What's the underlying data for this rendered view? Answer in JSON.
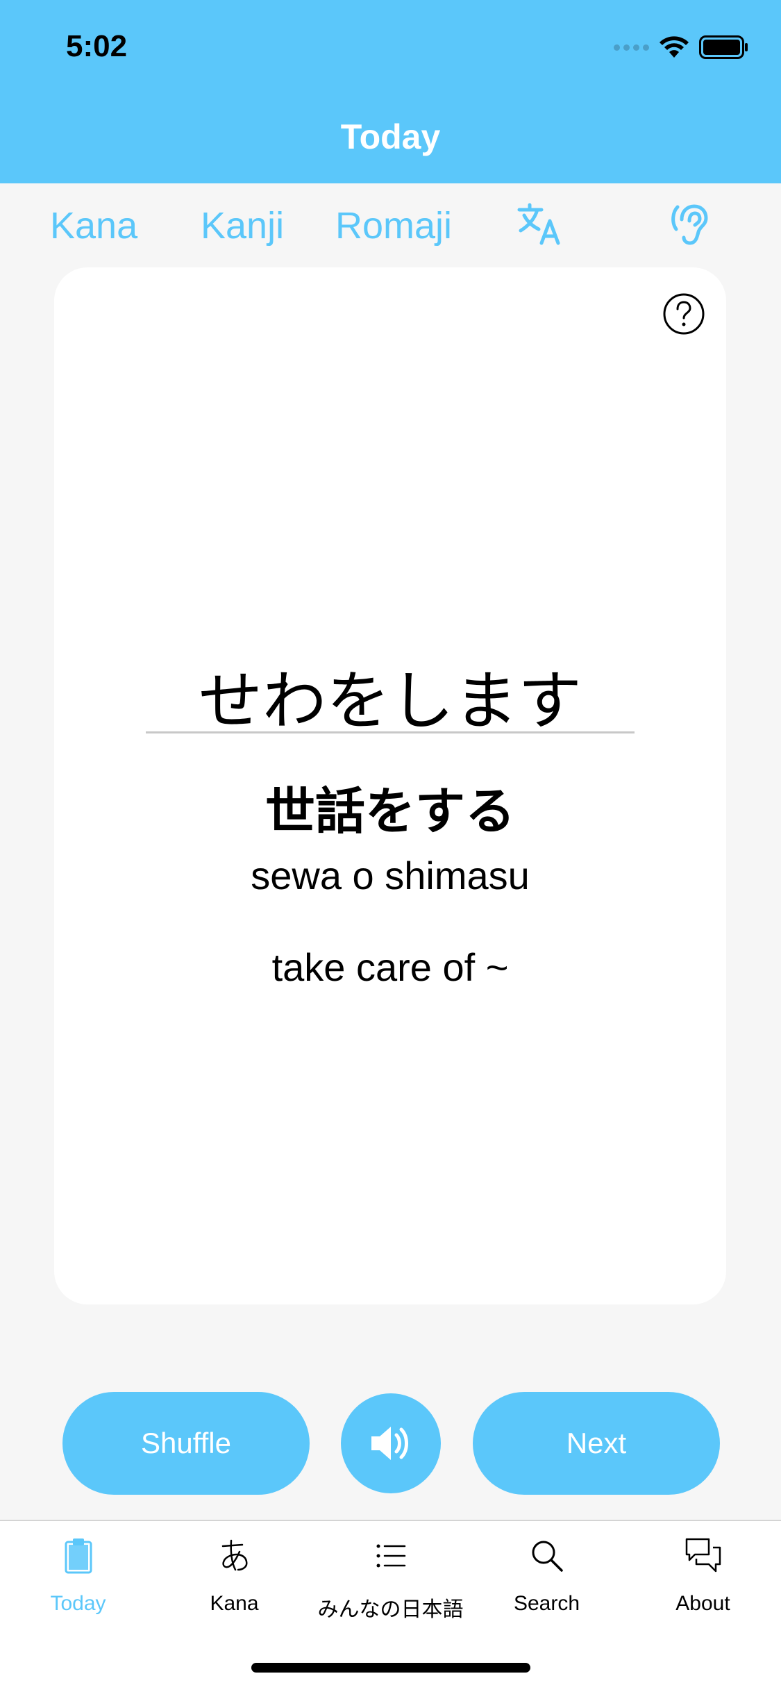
{
  "status_bar": {
    "time": "5:02"
  },
  "nav": {
    "title": "Today"
  },
  "mode_tabs": [
    {
      "label": "Kana"
    },
    {
      "label": "Kanji"
    },
    {
      "label": "Romaji"
    }
  ],
  "mode_icons": [
    "translate-icon",
    "hearing-icon"
  ],
  "card": {
    "kana": "せわをします",
    "kanji": "世話をする",
    "romaji": "sewa o shimasu",
    "meaning": "take care of ~"
  },
  "controls": {
    "shuffle_label": "Shuffle",
    "next_label": "Next",
    "sound_icon": "speaker-icon"
  },
  "tabbar": {
    "items": [
      {
        "label": "Today",
        "icon": "clipboard-icon",
        "active": true
      },
      {
        "label": "Kana",
        "icon": "hiragana-a-icon",
        "active": false
      },
      {
        "label": "みんなの日本語",
        "icon": "list-icon",
        "active": false
      },
      {
        "label": "Search",
        "icon": "search-icon",
        "active": false
      },
      {
        "label": "About",
        "icon": "chat-bubbles-icon",
        "active": false
      }
    ]
  },
  "colors": {
    "accent": "#5bc7fa",
    "background": "#f6f6f6",
    "card": "#ffffff"
  }
}
